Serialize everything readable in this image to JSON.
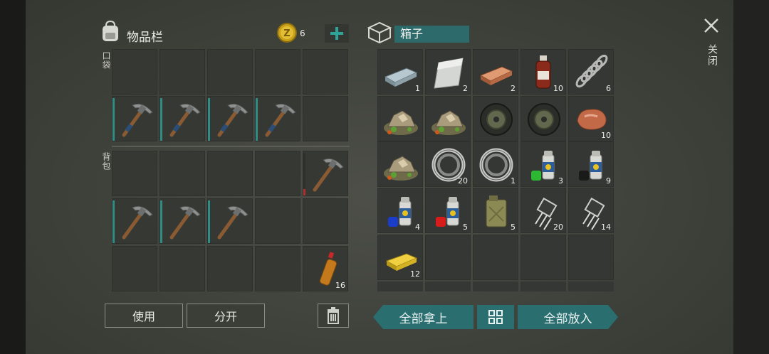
{
  "inventory": {
    "title": "物品栏",
    "coin_count": "6",
    "pocket_label": "口袋",
    "backpack_label": "背包",
    "use_button": "使用",
    "split_button": "分开"
  },
  "box": {
    "title": "箱子",
    "take_all": "全部拿上",
    "put_all": "全部放入"
  },
  "close_label": "关闭",
  "counts": {
    "steel_bar": "1",
    "aluminum": "2",
    "copper_bar": "2",
    "bottle": "10",
    "spring": "6",
    "rock_ore": "10",
    "bearing_a": "20",
    "bearing_b": "1",
    "spray_green": "3",
    "spray_black": "9",
    "spray_blue": "4",
    "spray_red": "5",
    "jerrycan": "5",
    "chip_a": "20",
    "chip_b": "14",
    "gold": "12",
    "soda": "16"
  }
}
